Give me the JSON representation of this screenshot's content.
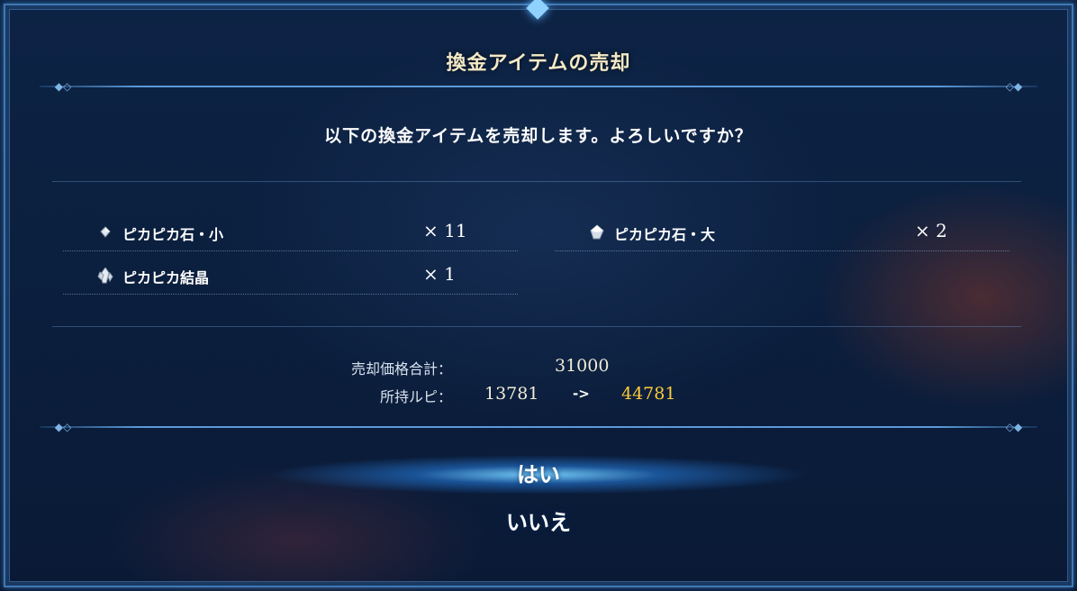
{
  "dialog": {
    "title": "換金アイテムの売却",
    "question": "以下の換金アイテムを売却します。よろしいですか？"
  },
  "items": [
    {
      "name": "ピカピカ石・小",
      "qty": "× 11",
      "icon": "small-stone-icon"
    },
    {
      "name": "ピカピカ石・大",
      "qty": "× 2",
      "icon": "large-stone-icon"
    },
    {
      "name": "ピカピカ結晶",
      "qty": "× 1",
      "icon": "crystal-icon"
    }
  ],
  "summary": {
    "total_label": "売却価格合計：",
    "total_value": "31000",
    "rupie_label": "所持ルピ：",
    "rupie_before": "13781",
    "arrow": "->",
    "rupie_after": "44781"
  },
  "buttons": {
    "yes": "はい",
    "no": "いいえ"
  },
  "colors": {
    "accent_gold": "#ffcc3a",
    "title_cream": "#f3e9c6",
    "frame_blue": "#3f78b4"
  }
}
